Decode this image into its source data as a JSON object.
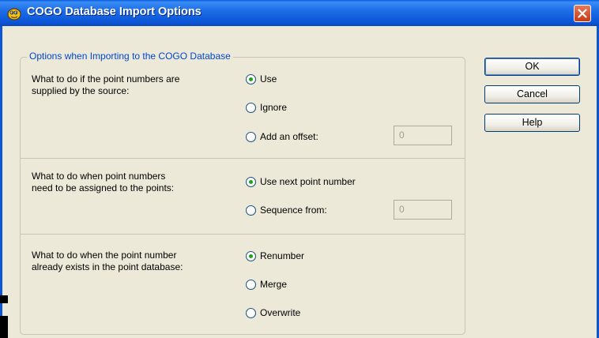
{
  "window": {
    "title": "COGO Database Import Options",
    "title_bar_color": "#0b55d6"
  },
  "group": {
    "legend": "Options when Importing to the COGO Database",
    "legend_color": "#0046d5"
  },
  "sections": [
    {
      "question": "What to do if the point numbers are\nsupplied by the source:",
      "options": [
        {
          "label": "Use",
          "checked": true
        },
        {
          "label": "Ignore",
          "checked": false
        },
        {
          "label": "Add an offset:",
          "checked": false
        }
      ],
      "field_value": "0"
    },
    {
      "question": "What to do when point numbers\nneed to be assigned to the points:",
      "options": [
        {
          "label": "Use next point number",
          "checked": true
        },
        {
          "label": "Sequence from:",
          "checked": false
        }
      ],
      "field_value": "0"
    },
    {
      "question": "What to do when the point number\nalready exists in the point database:",
      "options": [
        {
          "label": "Renumber",
          "checked": true
        },
        {
          "label": "Merge",
          "checked": false
        },
        {
          "label": "Overwrite",
          "checked": false
        }
      ]
    }
  ],
  "buttons": {
    "ok": "OK",
    "cancel": "Cancel",
    "help": "Help"
  }
}
